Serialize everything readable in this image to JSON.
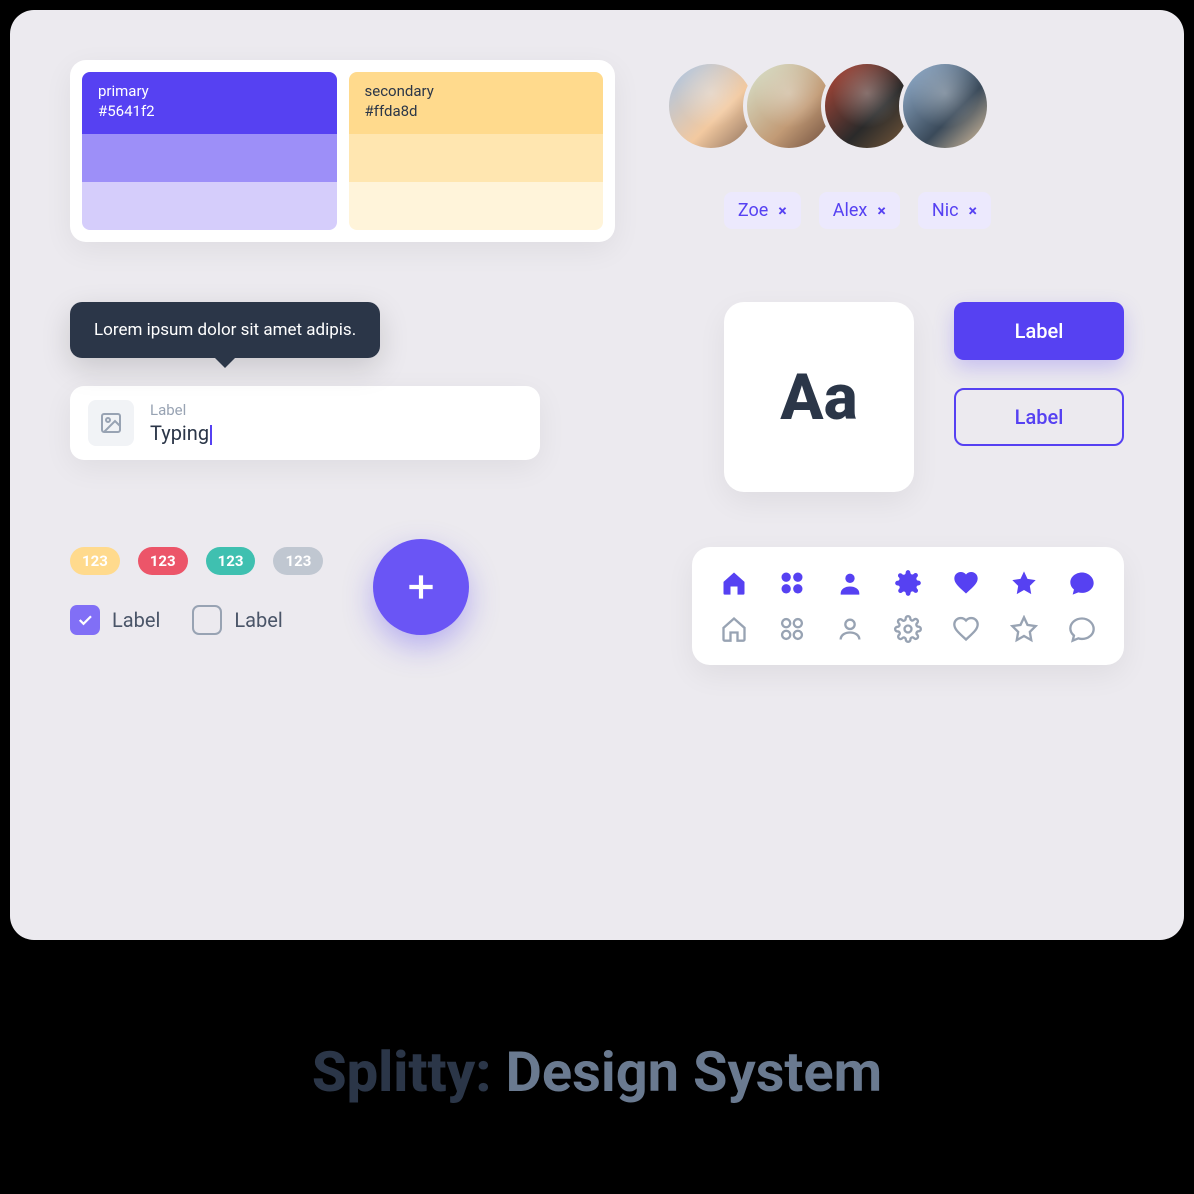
{
  "colors": {
    "primary": {
      "label": "primary",
      "hex": "#5641f2"
    },
    "secondary": {
      "label": "secondary",
      "hex": "#ffda8d"
    }
  },
  "chips": [
    {
      "name": "Zoe"
    },
    {
      "name": "Alex"
    },
    {
      "name": "Nic"
    }
  ],
  "tooltip": {
    "text": "Lorem ipsum dolor sit amet adipis."
  },
  "input": {
    "label": "Label",
    "value": "Typing"
  },
  "typography": {
    "sample": "Aa"
  },
  "buttons": {
    "primary": "Label",
    "outline": "Label"
  },
  "badges": [
    {
      "text": "123",
      "variant": "y"
    },
    {
      "text": "123",
      "variant": "r"
    },
    {
      "text": "123",
      "variant": "g"
    },
    {
      "text": "123",
      "variant": "gr"
    }
  ],
  "checkboxes": {
    "checked": "Label",
    "unchecked": "Label"
  },
  "title": {
    "brand": "Splitty:",
    "rest": "Design System"
  },
  "chip_close": "×"
}
